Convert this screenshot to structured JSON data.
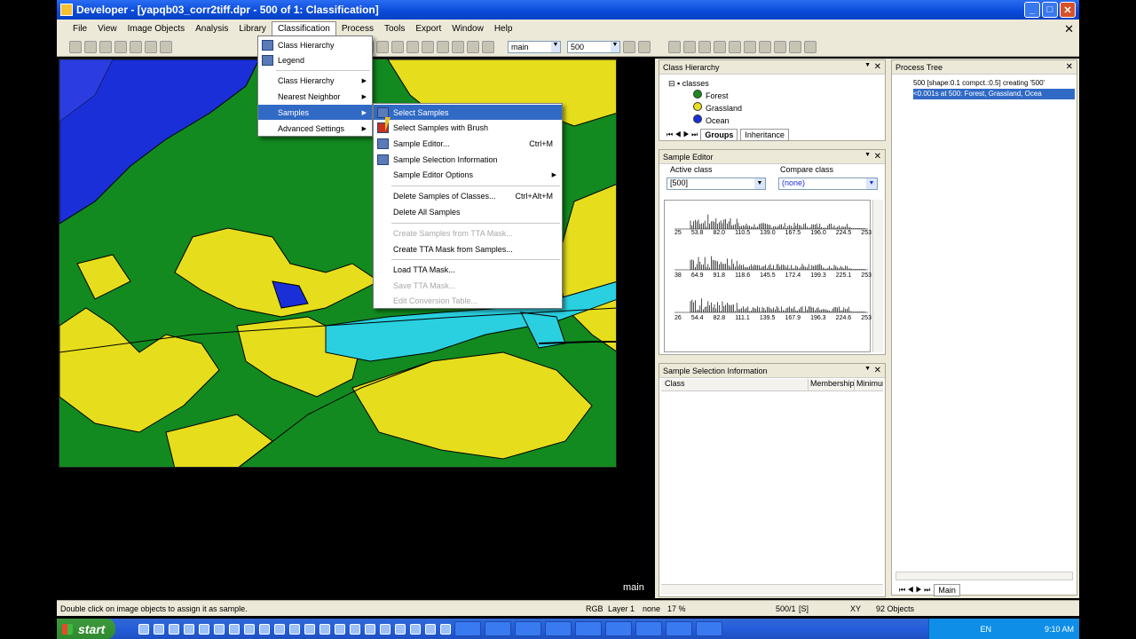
{
  "window": {
    "title": "Developer - [yapqb03_corr2tiff.dpr - 500 of 1: Classification]"
  },
  "menubar": {
    "items": [
      "File",
      "View",
      "Image Objects",
      "Analysis",
      "Library",
      "Classification",
      "Process",
      "Tools",
      "Export",
      "Window",
      "Help"
    ]
  },
  "toolbar": {
    "view_select": "main",
    "level_select": "500"
  },
  "classification_menu": {
    "items": [
      "Class Hierarchy",
      "Legend",
      "Class Hierarchy",
      "Nearest Neighbor",
      "Samples",
      "Advanced Settings"
    ]
  },
  "samples_submenu": {
    "items": [
      {
        "label": "Select Samples",
        "shortcut": ""
      },
      {
        "label": "Select Samples with Brush",
        "shortcut": ""
      },
      {
        "label": "Sample Editor...",
        "shortcut": "Ctrl+M"
      },
      {
        "label": "Sample Selection Information",
        "shortcut": ""
      },
      {
        "label": "Sample Editor Options",
        "shortcut": ""
      },
      {
        "label": "Delete Samples of Classes...",
        "shortcut": "Ctrl+Alt+M"
      },
      {
        "label": "Delete All Samples",
        "shortcut": ""
      },
      {
        "label": "Create Samples from TTA Mask...",
        "shortcut": ""
      },
      {
        "label": "Create TTA Mask from Samples...",
        "shortcut": ""
      },
      {
        "label": "Load TTA Mask...",
        "shortcut": ""
      },
      {
        "label": "Save TTA Mask...",
        "shortcut": ""
      },
      {
        "label": "Edit Conversion Table...",
        "shortcut": ""
      }
    ]
  },
  "class_hierarchy": {
    "title": "Class Hierarchy",
    "root": "classes",
    "classes": [
      {
        "name": "Forest",
        "color": "#1e8a1e"
      },
      {
        "name": "Grassland",
        "color": "#e8e020"
      },
      {
        "name": "Ocean",
        "color": "#1a2fd8"
      }
    ],
    "tabs": [
      "Groups",
      "Inheritance"
    ]
  },
  "sample_editor": {
    "title": "Sample Editor",
    "active_class_label": "Active class",
    "active_class_value": "[500]",
    "compare_class_label": "Compare class",
    "compare_class_value": "(none)",
    "hist1_ticks": [
      "25",
      "53.8",
      "82.0",
      "110.5",
      "139.0",
      "167.5",
      "196.0",
      "224.5",
      "253"
    ],
    "hist2_ticks": [
      "38",
      "64.9",
      "91.8",
      "118.6",
      "145.5",
      "172.4",
      "199.3",
      "225.1",
      "253"
    ],
    "hist3_ticks": [
      "26",
      "54.4",
      "82.8",
      "111.1",
      "139.5",
      "167.9",
      "196.3",
      "224.6",
      "253"
    ]
  },
  "sample_selection_info": {
    "title": "Sample Selection Information",
    "columns": [
      "Class",
      "Membership",
      "Minimum"
    ]
  },
  "process_tree": {
    "title": "Process Tree",
    "items": [
      "500 [shape:0.1 compct.:0.5] creating '500'",
      "<0.001s  at 500: Forest, Grassland, Ocea"
    ],
    "bottom_tab": "Main"
  },
  "view": {
    "label": "main"
  },
  "statusbar": {
    "hint": "Double click on image objects to assign it as sample.",
    "rgb": "RGB",
    "layer": "Layer 1",
    "none": "none",
    "zoom": "17 %",
    "level": "500/1",
    "s": "[S]",
    "xy": "XY",
    "objects": "92 Objects"
  },
  "taskbar": {
    "start": "start",
    "lang": "EN",
    "time": "9:10 AM"
  }
}
